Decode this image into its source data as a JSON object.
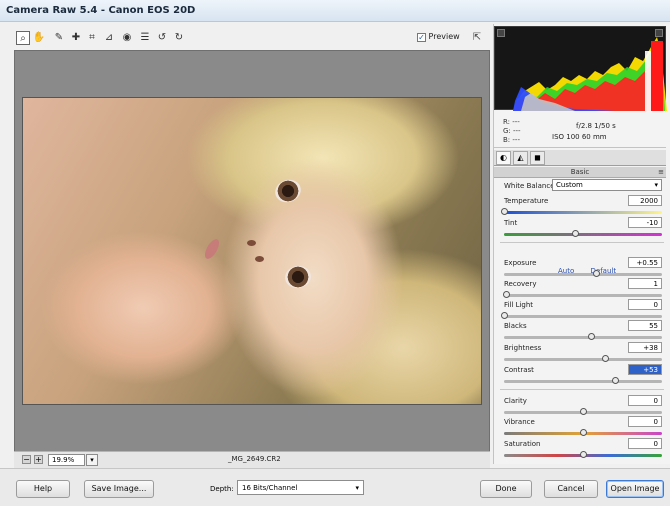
{
  "window": {
    "title": "Camera Raw 5.4  -  Canon EOS 20D"
  },
  "toolbar": {
    "tools": [
      {
        "name": "zoom-tool-icon",
        "glyph": "⌕"
      },
      {
        "name": "hand-tool-icon",
        "glyph": "✋"
      },
      {
        "name": "white-balance-tool-icon",
        "glyph": "✎"
      },
      {
        "name": "color-sampler-tool-icon",
        "glyph": "✚"
      },
      {
        "name": "crop-tool-icon",
        "glyph": "⌗"
      },
      {
        "name": "straighten-tool-icon",
        "glyph": "⊿"
      },
      {
        "name": "red-eye-tool-icon",
        "glyph": "◉"
      },
      {
        "name": "preferences-icon",
        "glyph": "☰"
      },
      {
        "name": "rotate-left-icon",
        "glyph": "↺"
      },
      {
        "name": "rotate-right-icon",
        "glyph": "↻"
      }
    ],
    "preview_label": "Preview",
    "preview_checked": "✓",
    "fullscreen_glyph": "⇱"
  },
  "status": {
    "zoom_minus": "−",
    "zoom_plus": "+",
    "zoom_value": "19.9%",
    "zoom_arrow": "▾",
    "filename": "_MG_2649.CR2"
  },
  "histogram": {
    "clip_left": "▲",
    "clip_right": "▲"
  },
  "readout": {
    "r": "R:  ---",
    "g": "G:  ---",
    "b": "B:  ---",
    "aperture_shutter": "f/2.8   1/50 s",
    "iso_focal": "ISO 100   60 mm"
  },
  "tabs": [
    {
      "name": "tab-basic",
      "glyph": "◐"
    },
    {
      "name": "tab-tone-curve",
      "glyph": "◭"
    },
    {
      "name": "tab-detail",
      "glyph": "◼"
    }
  ],
  "panel": {
    "title": "Basic",
    "menu_glyph": "≡"
  },
  "white_balance": {
    "label": "White Balance:",
    "value": "Custom",
    "arrow": "▾"
  },
  "sliders": {
    "temperature": {
      "label": "Temperature",
      "value": "2000",
      "position": 0.0
    },
    "tint": {
      "label": "Tint",
      "value": "-10",
      "position": 0.45
    },
    "exposure": {
      "label": "Exposure",
      "value": "+0.55",
      "position": 0.58
    },
    "recovery": {
      "label": "Recovery",
      "value": "1",
      "position": 0.01
    },
    "fill_light": {
      "label": "Fill Light",
      "value": "0",
      "position": 0.0
    },
    "blacks": {
      "label": "Blacks",
      "value": "55",
      "position": 0.55
    },
    "brightness": {
      "label": "Brightness",
      "value": "+38",
      "position": 0.64
    },
    "contrast": {
      "label": "Contrast",
      "value": "+53",
      "position": 0.7
    },
    "clarity": {
      "label": "Clarity",
      "value": "0",
      "position": 0.5
    },
    "vibrance": {
      "label": "Vibrance",
      "value": "0",
      "position": 0.5
    },
    "saturation": {
      "label": "Saturation",
      "value": "0",
      "position": 0.5
    }
  },
  "auto_label": "Auto",
  "default_label": "Default",
  "footer": {
    "help": "Help",
    "save_image": "Save Image...",
    "depth_label": "Depth:",
    "depth_value": "16 Bits/Channel",
    "depth_arrow": "▾",
    "done": "Done",
    "cancel": "Cancel",
    "open_image": "Open Image"
  }
}
